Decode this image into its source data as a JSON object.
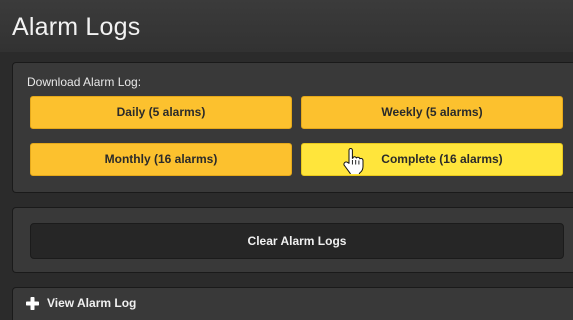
{
  "header": {
    "title": "Alarm Logs"
  },
  "download": {
    "label": "Download Alarm Log:",
    "buttons": {
      "daily": "Daily (5 alarms)",
      "weekly": "Weekly (5 alarms)",
      "monthly": "Monthly (16 alarms)",
      "complete": "Complete (16 alarms)"
    }
  },
  "clear": {
    "label": "Clear Alarm Logs"
  },
  "view": {
    "label": "View Alarm Log",
    "icon": "plus-icon"
  },
  "pointer": {
    "icon": "hand-pointer-icon",
    "hovered_button": "complete"
  },
  "colors": {
    "button_yellow": "#fcc12e",
    "button_yellow_hover": "#ffe53b",
    "panel": "#393939",
    "background": "#2b2b2b",
    "clear_button": "#262626"
  }
}
